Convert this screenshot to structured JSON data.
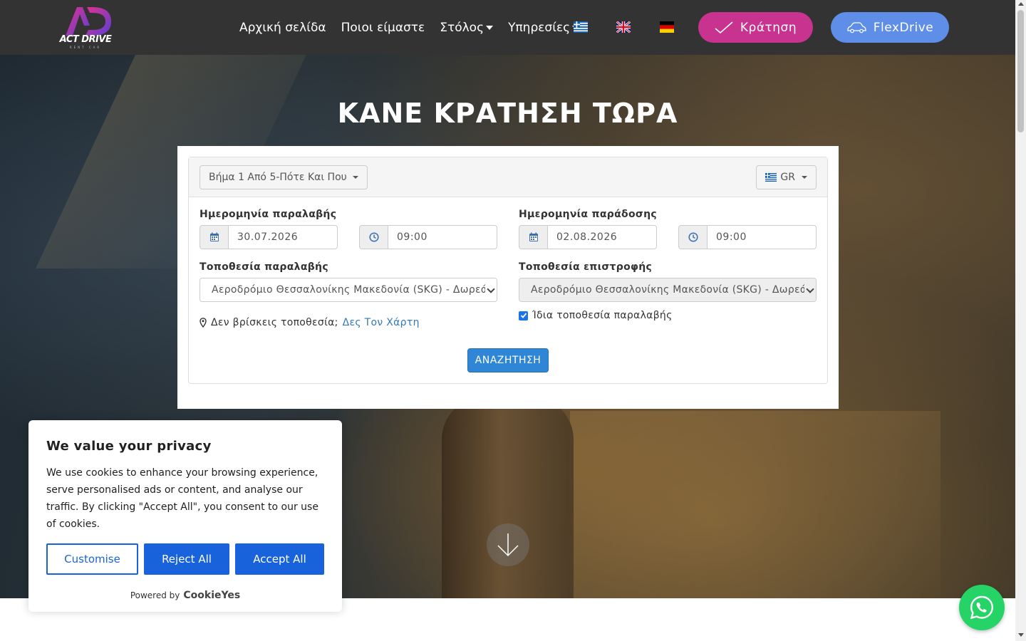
{
  "header": {
    "logo": {
      "text": "ACT DRIVE",
      "subtext": "RENT CAR",
      "monogram": "AD"
    },
    "nav": [
      {
        "label": "Αρχική σελίδα",
        "dropdown": false
      },
      {
        "label": "Ποιοι είμαστε",
        "dropdown": false
      },
      {
        "label": "Στόλος",
        "dropdown": true
      },
      {
        "label": "Υπηρεσίες",
        "dropdown": true
      }
    ],
    "flags": [
      "greek-flag-icon",
      "uk-flag-icon",
      "german-flag-icon"
    ],
    "book_button": "Κράτηση",
    "flex_button": "FlexDrive",
    "colors": {
      "bar": "#333333",
      "book": "#c8338f",
      "flex": "#5e8ee8"
    }
  },
  "hero": {
    "title": "ΚΑΝΕ ΚΡΑΤΗΣΗ ΤΩΡΑ"
  },
  "booking": {
    "step_label": "Βήμα 1 Από 5-Πότε Και Που",
    "language": "GR",
    "pickup_date_label": "Ημερομηνία παραλαβής",
    "pickup_date": "30.07.2026",
    "pickup_time": "09:00",
    "return_date_label": "Ημερομηνία παράδοσης",
    "return_date": "02.08.2026",
    "return_time": "09:00",
    "pickup_location_label": "Τοποθεσία παραλαβής",
    "pickup_location": "Αεροδρόμιο Θεσσαλονίκης Μακεδονία (SKG) - Δωρεάν",
    "return_location_label": "Τοποθεσία επιστροφής",
    "return_location": "Αεροδρόμιο Θεσσαλονίκης Μακεδονία (SKG) - Δωρεάν",
    "map_prompt": "Δεν βρίσκεις τοποθεσία;",
    "map_link": "Δες Τον Χάρτη",
    "same_location_label": "Ίδια τοποθεσία παραλαβής",
    "same_location_checked": true,
    "search_button": "ΑΝΑΖΗΤΗΣΗ"
  },
  "cookie": {
    "title": "We value your privacy",
    "text": "We use cookies to enhance your browsing experience, serve personalised ads or content, and analyse our traffic. By clicking \"Accept All\", you consent to our use of cookies.",
    "customise": "Customise",
    "reject": "Reject All",
    "accept": "Accept All",
    "powered_by": "Powered by",
    "brand": "CookieYes",
    "accent": "#1863dc"
  },
  "whatsapp": {
    "icon": "whatsapp-icon",
    "color": "#25d366"
  }
}
